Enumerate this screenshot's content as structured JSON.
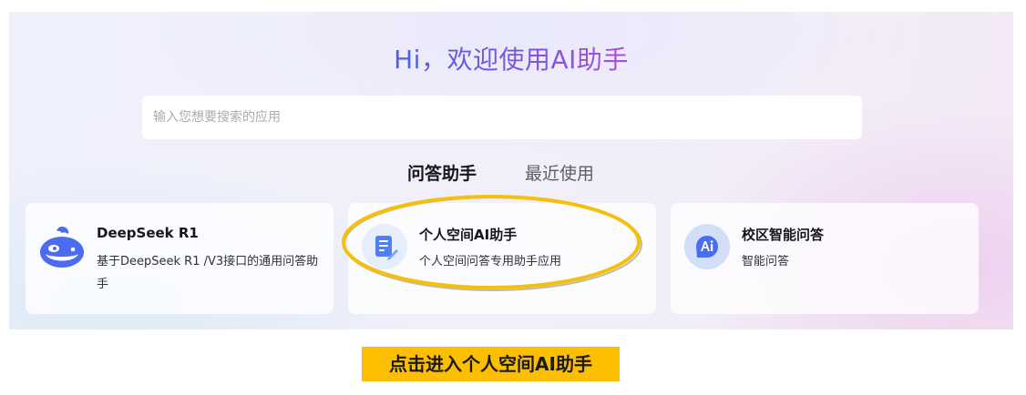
{
  "header": {
    "title": "Hi，欢迎使用AI助手"
  },
  "search": {
    "placeholder": "输入您想要搜索的应用",
    "value": ""
  },
  "tabs": [
    {
      "label": "问答助手",
      "active": true
    },
    {
      "label": "最近使用",
      "active": false
    }
  ],
  "cards": [
    {
      "title": "DeepSeek R1",
      "desc": "基于DeepSeek R1 /V3接口的通用问答助手",
      "icon": "whale-icon"
    },
    {
      "title": "个人空间AI助手",
      "desc": "个人空间问答专用助手应用",
      "icon": "document-edit-icon"
    },
    {
      "title": "校区智能问答",
      "desc": "智能问答",
      "icon": "ai-chat-icon"
    }
  ],
  "annotation": {
    "caption": "点击进入个人空间AI助手"
  },
  "colors": {
    "title_gradient_start": "#4b63e6",
    "title_gradient_end": "#b04ed6",
    "accent_blue": "#4f6ef7",
    "highlight_ring": "#f5c00d",
    "caption_bg": "#fbbf00"
  }
}
